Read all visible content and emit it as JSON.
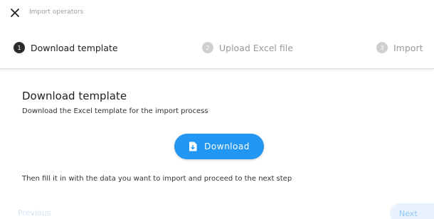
{
  "header": {
    "close_icon": "close-icon",
    "title": "Import operators"
  },
  "stepper": {
    "steps": [
      {
        "number": "1",
        "label": "Download template",
        "state": "active"
      },
      {
        "number": "2",
        "label": "Upload Excel file",
        "state": "inactive"
      },
      {
        "number": "3",
        "label": "Import",
        "state": "inactive"
      }
    ]
  },
  "content": {
    "title": "Download template",
    "description": "Download the Excel template for the import process",
    "download_button": {
      "label": "Download",
      "icon": "file-download-icon"
    },
    "instruction": "Then fill it in with the data you want to import and proceed to the next step"
  },
  "footer": {
    "previous_label": "Previous",
    "next_label": "Next"
  },
  "colors": {
    "accent": "#2196f3",
    "active_step": "#2b2b2b",
    "inactive_step": "#cfcfcf"
  }
}
